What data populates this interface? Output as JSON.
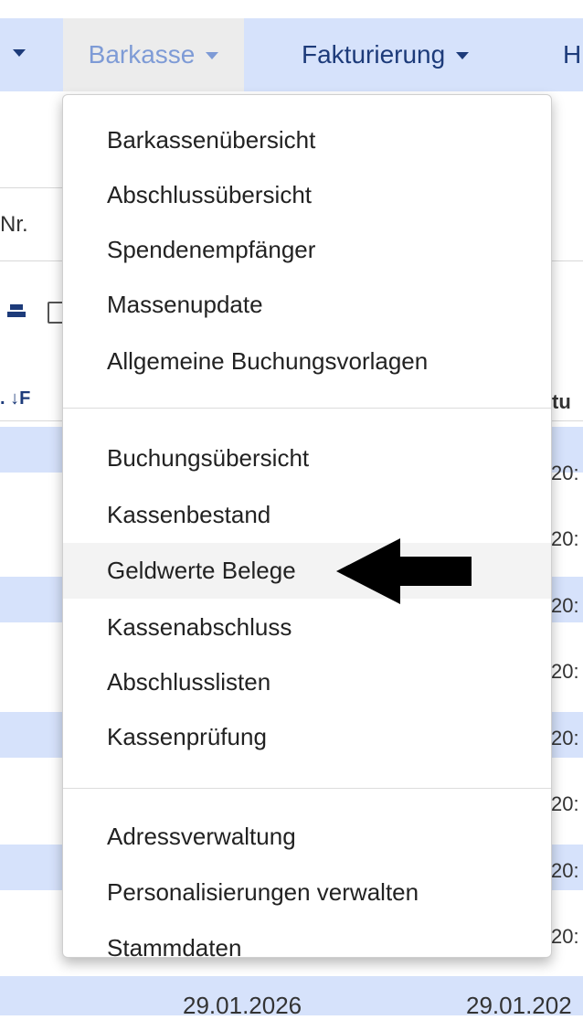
{
  "navbar": {
    "tabs": [
      {
        "label": "Barkasse",
        "active": true
      },
      {
        "label": "Fakturierung"
      },
      {
        "label": "H"
      }
    ]
  },
  "background": {
    "column_label": "Nr.",
    "sort_label": ". ↓F",
    "column_label_right": "tu",
    "date_fragments": [
      "20:",
      "20:",
      "20:",
      "20:",
      "20:",
      "20:",
      "20:",
      "20:",
      "20:"
    ],
    "bottom_dates": [
      "29.01.2026",
      "29.01.202"
    ]
  },
  "dropdown": {
    "groups": [
      [
        "Barkassenübersicht",
        "Abschlussübersicht",
        "Spendenempfänger",
        "Massenupdate",
        "Allgemeine Buchungsvorlagen"
      ],
      [
        "Buchungsübersicht",
        "Kassenbestand",
        "Geldwerte Belege",
        "Kassenabschluss",
        "Abschlusslisten",
        "Kassenprüfung"
      ],
      [
        "Adressverwaltung",
        "Personalisierungen verwalten",
        "Stammdaten"
      ]
    ],
    "highlighted": "Geldwerte Belege"
  },
  "colors": {
    "navbar_bg": "#d6e2fb",
    "nav_text": "#1d3b7a",
    "active_tab_text": "#7e9bd6",
    "row_band": "#d6e2fb"
  },
  "icons": {
    "nav_caret": "caret-down-icon",
    "annotation": "arrow-left-icon"
  }
}
